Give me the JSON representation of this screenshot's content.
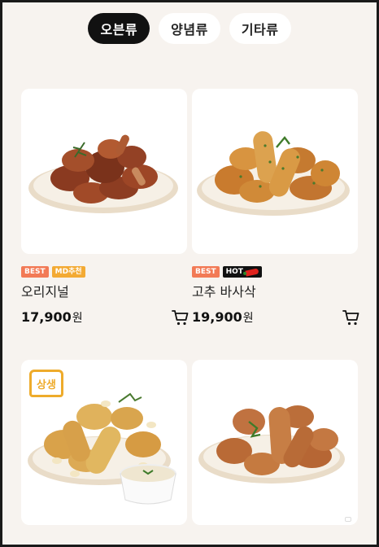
{
  "tabs": [
    {
      "label": "오븐류",
      "active": true
    },
    {
      "label": "양념류",
      "active": false
    },
    {
      "label": "기타류",
      "active": false
    }
  ],
  "products": [
    {
      "name": "오리지널",
      "price": "17,900",
      "currency": "원",
      "badges": [
        "BEST",
        "MD추천"
      ],
      "image": "roasted-chicken-plate"
    },
    {
      "name": "고추 바사삭",
      "price": "19,900",
      "currency": "원",
      "badges": [
        "BEST",
        "HOT"
      ],
      "image": "pepper-crispy-chicken-plate"
    },
    {
      "name": "",
      "price": "",
      "currency": "",
      "badges": [],
      "image": "crispy-chicken-with-dip",
      "overlay_badge": "상생"
    },
    {
      "name": "",
      "price": "",
      "currency": "",
      "badges": [],
      "image": "fried-chicken-plate"
    }
  ],
  "colors": {
    "background": "#f7f3ef",
    "tab_active": "#111111",
    "badge_best": "#f27a56",
    "badge_md": "#f3aa34",
    "badge_hot": "#111111",
    "logo_badge": "#eeab2b"
  }
}
